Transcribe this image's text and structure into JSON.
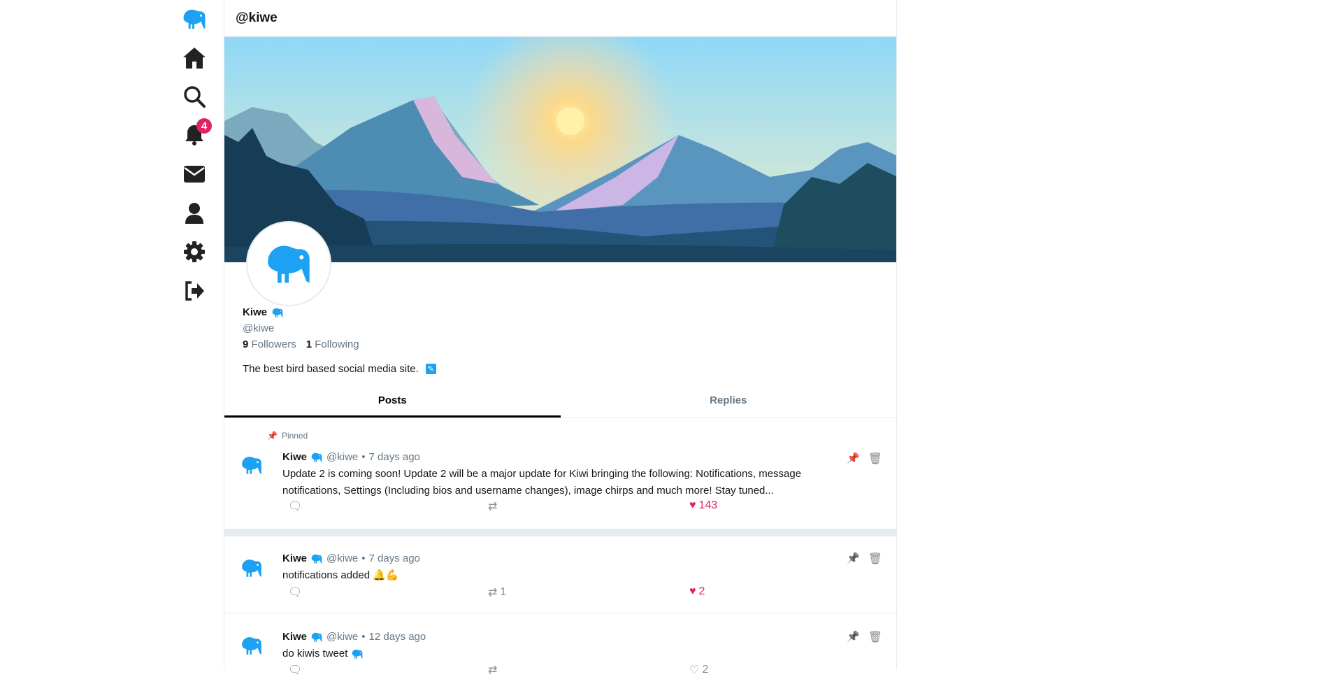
{
  "header": {
    "title": "@kiwe"
  },
  "sidebar": {
    "notification_count": "4",
    "items": [
      "home",
      "search",
      "notifications",
      "messages",
      "profile",
      "settings",
      "logout"
    ]
  },
  "profile": {
    "name": "Kiwe",
    "handle": "@kiwe",
    "followers_count": "9",
    "followers_label": "Followers",
    "following_count": "1",
    "following_label": "Following",
    "bio": "The best bird based social media site."
  },
  "tabs": [
    {
      "label": "Posts",
      "active": true
    },
    {
      "label": "Replies",
      "active": false
    }
  ],
  "pinned_label": "Pinned",
  "posts": [
    {
      "name": "Kiwe",
      "handle": "@kiwe",
      "time": "7 days ago",
      "text": "Update 2 is coming soon! Update 2 will be a major update for Kiwi bringing the following: Notifications, message notifications, Settings (Including bios and username changes), image chirps and much more! Stay tuned...",
      "retweets": "",
      "likes": "143",
      "liked": true,
      "pinned": true
    },
    {
      "name": "Kiwe",
      "handle": "@kiwe",
      "time": "7 days ago",
      "text": "notifications added 🔔💪",
      "retweets": "1",
      "likes": "2",
      "liked": true,
      "pinned": false
    },
    {
      "name": "Kiwe",
      "handle": "@kiwe",
      "time": "12 days ago",
      "text": "do kiwis tweet",
      "retweets": "",
      "likes": "2",
      "liked": false,
      "pinned": false
    }
  ],
  "colors": {
    "accent": "#1da1f2",
    "like": "#e0245e",
    "pin_active": "#f5b400"
  }
}
